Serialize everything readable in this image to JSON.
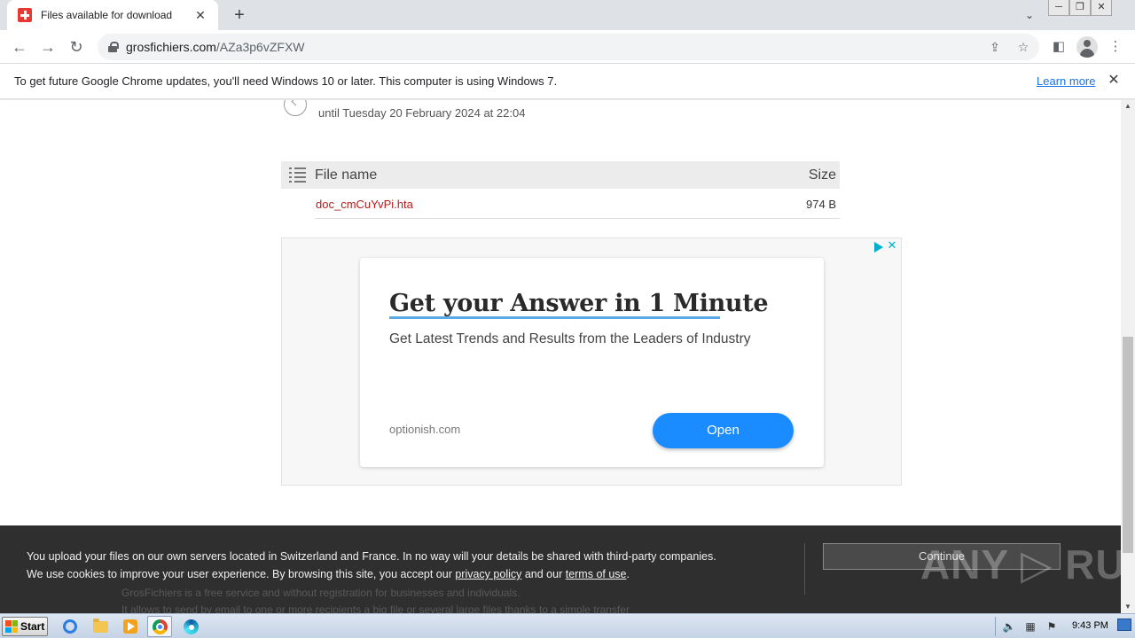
{
  "browser": {
    "tab": {
      "title": "Files available for download",
      "close": "✕"
    },
    "new_tab": "+",
    "url": {
      "host": "grosfichiers.com",
      "path": "/AZa3p6vZFXW"
    },
    "window_buttons": {
      "minimize": "─",
      "restore": "❐",
      "close": "✕"
    }
  },
  "infobar": {
    "message": "To get future Google Chrome updates, you'll need Windows 10 or later. This computer is using Windows 7.",
    "learn_more": "Learn more",
    "close": "✕"
  },
  "page": {
    "expiry": "until Tuesday 20 February 2024 at 22:04",
    "table": {
      "col_name": "File name",
      "col_size": "Size",
      "rows": [
        {
          "name": "doc_cmCuYvPi.hta",
          "size": "974 B"
        }
      ]
    }
  },
  "ad": {
    "headline": "Get your Answer in 1 Minute",
    "subtitle": "Get Latest Trends and Results from the Leaders of Industry",
    "domain": "optionish.com",
    "button": "Open",
    "close": "✕"
  },
  "cookie": {
    "line1": "You upload your files on our own servers located in Switzerland and France. In no way will your details be shared with third-party companies.",
    "line2_prefix": "We use cookies to improve your user experience. By browsing this site, you accept our ",
    "privacy_link": "privacy policy",
    "line2_mid": " and our ",
    "terms_link": "terms of use",
    "line2_suffix": ".",
    "button": "Continue",
    "bg_line1": "GrosFichiers is a  free service  and  without registration  for businesses and individuals.",
    "bg_line2": "It allows to send by email to one or more recipients a  big file  or several  large files  thanks to a simple transfer"
  },
  "watermark": "ANY ▷ RUN",
  "taskbar": {
    "start": "Start",
    "clock": "9:43 PM"
  },
  "colors": {
    "link_red": "#b71c1c",
    "accent_blue": "#1a8cff",
    "cookie_bg": "#2f2f2f"
  }
}
